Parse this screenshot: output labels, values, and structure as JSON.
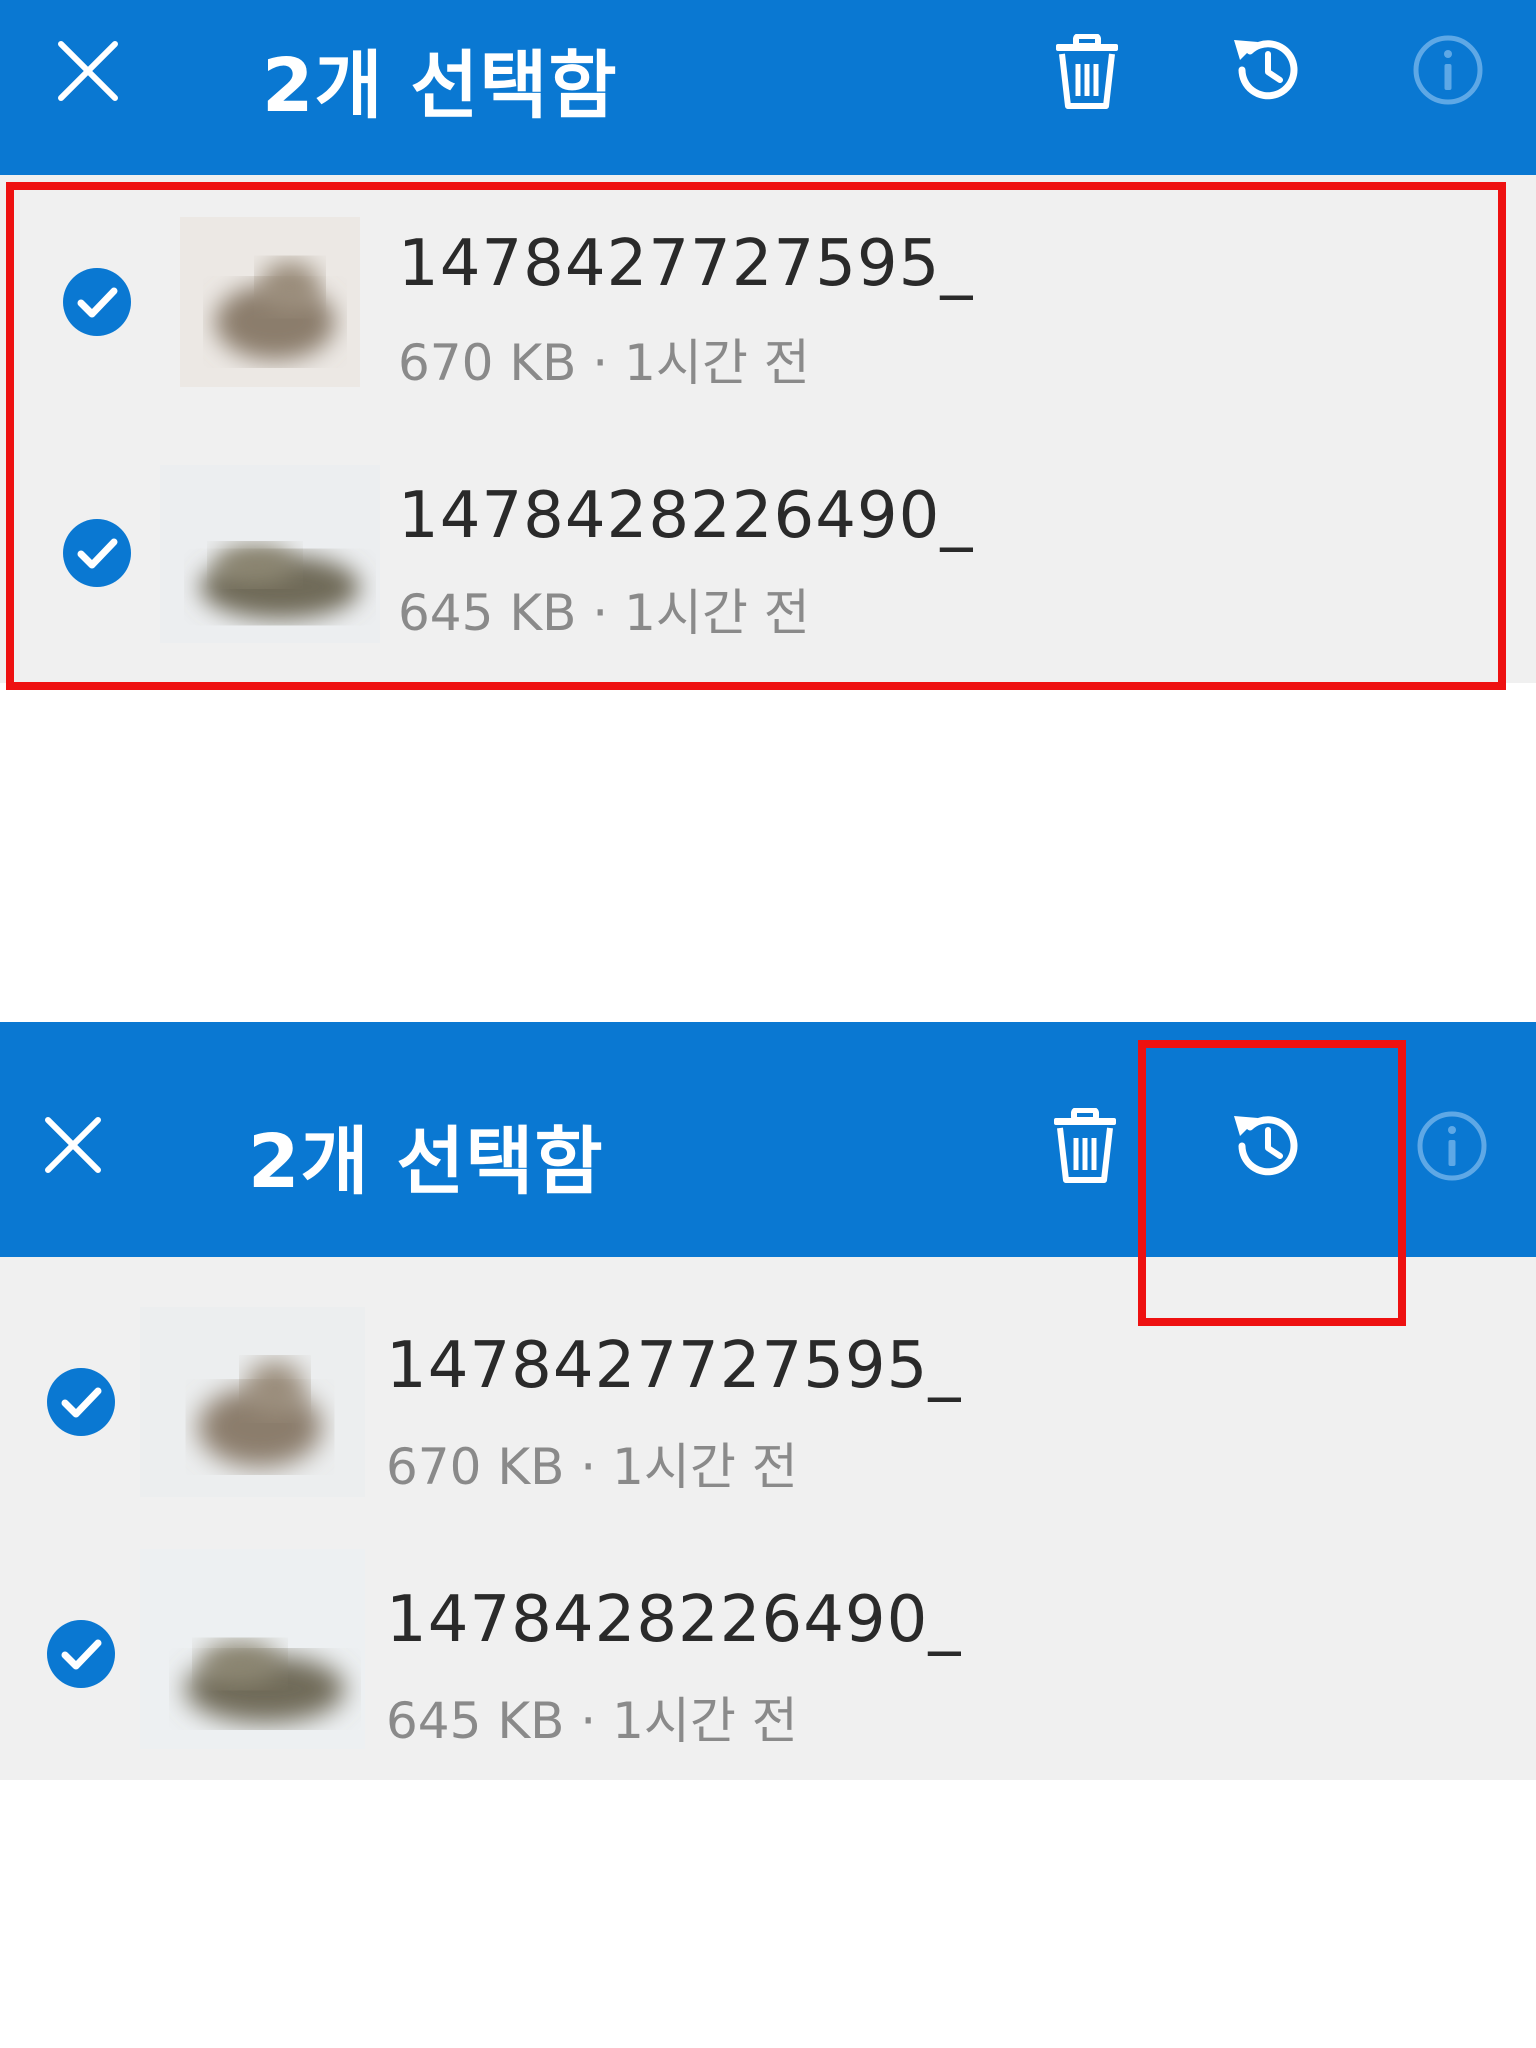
{
  "panels": [
    {
      "header": {
        "title": "2개 선택함",
        "close_icon": "close-icon",
        "delete_icon": "trash-icon",
        "restore_icon": "history-restore-icon",
        "info_icon": "info-icon"
      },
      "files": [
        {
          "name": "1478427727595_",
          "size": "670 KB",
          "time": "1시간 전",
          "meta": "670 KB · 1시간 전",
          "selected": true
        },
        {
          "name": "1478428226490_",
          "size": "645 KB",
          "time": "1시간 전",
          "meta": "645 KB · 1시간 전",
          "selected": true
        }
      ],
      "annotation": "selected-files-highlight"
    },
    {
      "header": {
        "title": "2개 선택함",
        "close_icon": "close-icon",
        "delete_icon": "trash-icon",
        "restore_icon": "history-restore-icon",
        "info_icon": "info-icon"
      },
      "files": [
        {
          "name": "1478427727595_",
          "size": "670 KB",
          "time": "1시간 전",
          "meta": "670 KB · 1시간 전",
          "selected": true
        },
        {
          "name": "1478428226490_",
          "size": "645 KB",
          "time": "1시간 전",
          "meta": "645 KB · 1시간 전",
          "selected": true
        }
      ],
      "annotation": "restore-button-highlight"
    }
  ],
  "colors": {
    "appbar": "#0a78d2",
    "list_bg": "#f0f0f0",
    "check": "#0a78d2",
    "highlight": "#ee1111",
    "info_disabled": "#5ea8e6"
  }
}
